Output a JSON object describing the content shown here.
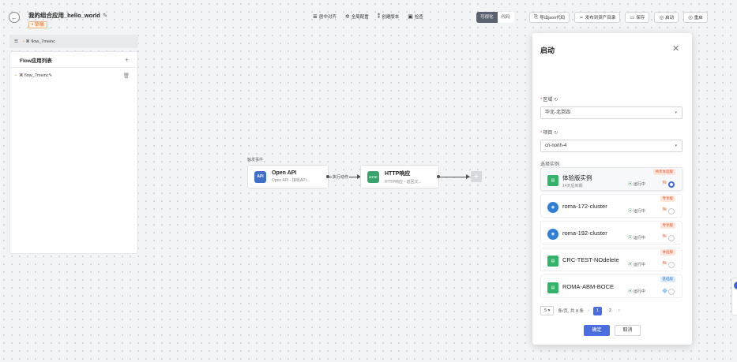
{
  "app": {
    "title": "我的组合应用_hello_world",
    "edit_icon": "pencil-icon",
    "status_tag": "• 草稿"
  },
  "toolbar": {
    "tools": [
      {
        "icon": "align-center-icon",
        "glyph": "≣",
        "label": "居中对齐"
      },
      {
        "icon": "gear-icon",
        "glyph": "✲",
        "label": "全局配置"
      },
      {
        "icon": "version-icon",
        "glyph": "⁑",
        "label": "创建版本"
      },
      {
        "icon": "check-icon",
        "glyph": "▣",
        "label": "检查"
      }
    ],
    "view_modes": {
      "visual": "可视化",
      "code": "代码"
    },
    "actions": [
      {
        "icon": "export-icon",
        "glyph": "⎘",
        "label": "导出json代码"
      },
      {
        "icon": "send-icon",
        "glyph": "➢",
        "label": "发布到资产目录"
      },
      {
        "icon": "save-icon",
        "glyph": "▭",
        "label": "保存"
      },
      {
        "icon": "start-icon",
        "glyph": "◎",
        "label": "启动"
      },
      {
        "icon": "restart-icon",
        "glyph": "◎",
        "label": "重启"
      }
    ]
  },
  "flow_selector": {
    "value": "flow_7meinc"
  },
  "left_panel": {
    "title": "Flow应用列表",
    "items": [
      {
        "label": "flow_7meinc"
      }
    ]
  },
  "canvas": {
    "trigger_label": "触发事件",
    "connector_label": "执行动作",
    "nodes": [
      {
        "title": "Open API",
        "subtitle": "Open API - 接收API...",
        "icon": "api-icon",
        "icon_text": "API"
      },
      {
        "title": "HTTP响应",
        "subtitle": "HTTP响应 - 返回文...",
        "icon": "http-icon",
        "icon_text": "HTTP"
      }
    ]
  },
  "modal": {
    "title": "启动",
    "region": {
      "label": "区域",
      "value": "华北-北京四"
    },
    "project": {
      "label": "项目",
      "value": "cn-north-4"
    },
    "instance_label": "选择实例",
    "instances": [
      {
        "name": "体验版实例",
        "sub": "14天后到期",
        "status": "运行中",
        "tag": "共享体验版",
        "tag_color": "red",
        "icon_color": "#35b36b",
        "selected": true
      },
      {
        "name": "roma-172-cluster",
        "sub": "",
        "status": "运行中",
        "tag": "专享版",
        "tag_color": "red",
        "icon_color": "#2f7fd8",
        "selected": false
      },
      {
        "name": "roma-192-cluster",
        "sub": "",
        "status": "运行中",
        "tag": "专享版",
        "tag_color": "red",
        "icon_color": "#2f7fd8",
        "selected": false
      },
      {
        "name": "CRC-TEST-NOdelete",
        "sub": "",
        "status": "运行中",
        "tag": "体验版",
        "tag_color": "red",
        "icon_color": "#35b36b",
        "selected": false
      },
      {
        "name": "ROMA-ABM-BOCE",
        "sub": "",
        "status": "运行中",
        "tag": "基础版",
        "tag_color": "blue",
        "icon_color": "#35b36b",
        "selected": false
      }
    ],
    "pagination": {
      "page_size": "5",
      "summary": "条/页, 共 8 条",
      "pages": [
        "1",
        "2"
      ],
      "current": "1"
    },
    "ok_label": "确定",
    "cancel_label": "取消"
  }
}
